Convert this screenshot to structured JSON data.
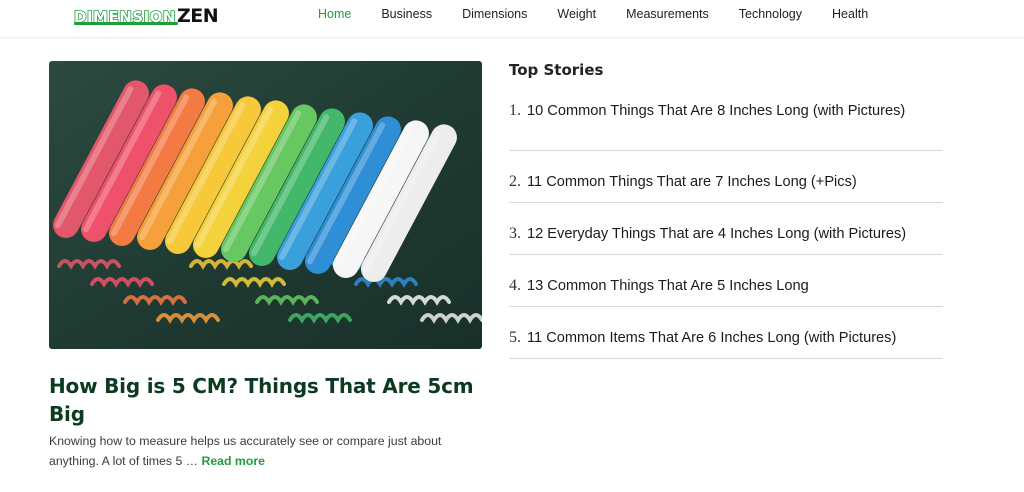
{
  "brand": {
    "part1": "DIMENSION",
    "part2": "ZEN",
    "accent": "#1f9e3e",
    "dark": "#0d3b22"
  },
  "nav": [
    "Home",
    "Business",
    "Dimensions",
    "Weight",
    "Measurements",
    "Technology",
    "Health"
  ],
  "featured": {
    "title": "How Big is 5 CM? Things That Are 5cm Big",
    "excerpt": "Knowing how to measure helps us accurately see or compare just about anything. A lot of times 5 …",
    "read_more": "Read more",
    "image_icon": "colored-chalk-sticks-photo",
    "chalk_colors": [
      "#e2576a",
      "#f0516a",
      "#f47a43",
      "#f6a03b",
      "#f6c83a",
      "#f3d23c",
      "#67c761",
      "#43b86a",
      "#3aa0dc",
      "#2f8fd6",
      "#f6f6f6",
      "#ededed"
    ]
  },
  "sidebar": {
    "title": "Top Stories",
    "stories": [
      {
        "num": "1.",
        "text": "10 Common Things That Are 8 Inches Long (with Pictures)"
      },
      {
        "num": "2.",
        "text": "11 Common Things That are 7 Inches Long (+Pics)"
      },
      {
        "num": "3.",
        "text": "12 Everyday Things That are 4 Inches Long (with Pictures)"
      },
      {
        "num": "4.",
        "text": "13 Common Things That Are 5 Inches Long"
      },
      {
        "num": "5.",
        "text": "11 Common Items That Are 6 Inches Long (with Pictures)"
      }
    ]
  }
}
